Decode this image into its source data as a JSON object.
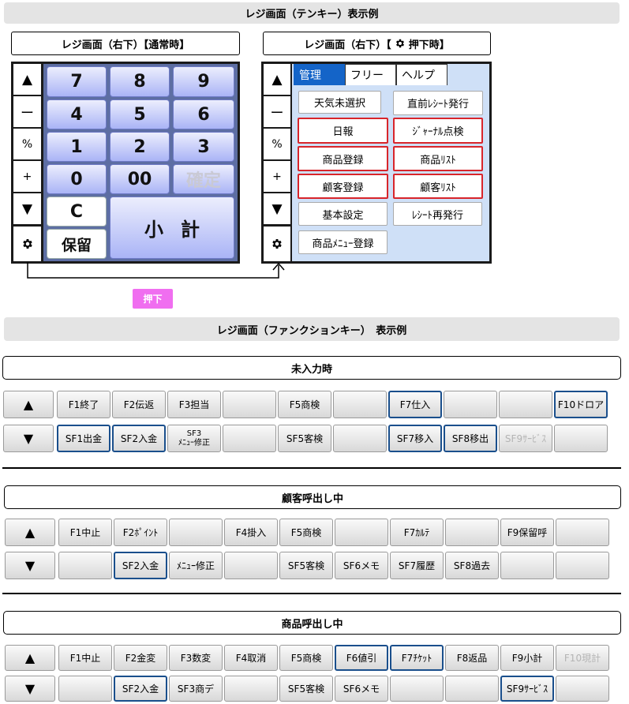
{
  "top_banner": "レジ画面（テンキー）表示例",
  "panel_normal_title": "レジ画面（右下）【通常時】",
  "panel_pressed_title_pre": "レジ画面（右下）【",
  "panel_pressed_title_post": "押下時】",
  "side_buttons": [
    "▲",
    "ー",
    "%",
    "+",
    "▼"
  ],
  "keypad": {
    "row1": [
      "7",
      "8",
      "9"
    ],
    "row2": [
      "4",
      "5",
      "6"
    ],
    "row3": [
      "1",
      "2",
      "3"
    ],
    "row4": [
      "0",
      "00",
      "確定"
    ],
    "clear": "C",
    "hold": "保留",
    "subtotal": "小計"
  },
  "tabs": [
    "管理",
    "フリー",
    "ヘルプ"
  ],
  "mgmt_buttons": [
    [
      "天気未選択",
      "直前ﾚｼｰﾄ発行"
    ],
    [
      "日報",
      "ｼﾞｬｰﾅﾙ点検"
    ],
    [
      "商品登録",
      "商品ﾘｽﾄ"
    ],
    [
      "顧客登録",
      "顧客ﾘｽﾄ"
    ],
    [
      "基本設定",
      "ﾚｼｰﾄ再発行"
    ],
    [
      "商品ﾒﾆｭｰ登録",
      ""
    ]
  ],
  "press_label": "押下",
  "fk_banner": "レジ画面（ファンクションキー）　表示例",
  "sections": [
    {
      "title": "未入力時",
      "row1": [
        "▲",
        "F1終了",
        "F2伝返",
        "F3担当",
        "",
        "F5商検",
        "",
        "F7仕入",
        "",
        "",
        "F10ドロア"
      ],
      "row2": [
        "▼",
        "SF1出金",
        "SF2入金",
        "SF3\nﾒﾆｭｰ修正",
        "",
        "SF5客検",
        "",
        "SF7移入",
        "SF8移出",
        "SF9ｻｰﾋﾞｽ",
        ""
      ]
    },
    {
      "title": "顧客呼出し中",
      "row1": [
        "▲",
        "F1中止",
        "F2ﾎﾟｲﾝﾄ",
        "",
        "F4掛入",
        "F5商検",
        "",
        "F7ｶﾙﾃ",
        "",
        "F9保留呼",
        ""
      ],
      "row2": [
        "▼",
        "",
        "SF2入金",
        "ﾒﾆｭｰ修正",
        "",
        "SF5客検",
        "SF6メモ",
        "SF7履歴",
        "SF8過去",
        "",
        ""
      ]
    },
    {
      "title": "商品呼出し中",
      "row1": [
        "▲",
        "F1中止",
        "F2金変",
        "F3数変",
        "F4取消",
        "F5商検",
        "F6値引",
        "F7ﾁｹｯﾄ",
        "F8返品",
        "F9小計",
        "F10現計"
      ],
      "row2": [
        "▼",
        "",
        "SF2入金",
        "SF3商デ",
        "",
        "SF5客検",
        "SF6メモ",
        "",
        "",
        "SF9ｻｰﾋﾞｽ",
        ""
      ]
    }
  ],
  "colors": {
    "keypad_bg": "#5d6ea3",
    "tab_active": "#1464c8",
    "highlight_red": "#d8252b",
    "highlight_blue": "#1a4f8c",
    "press_badge": "#f06ef0"
  }
}
